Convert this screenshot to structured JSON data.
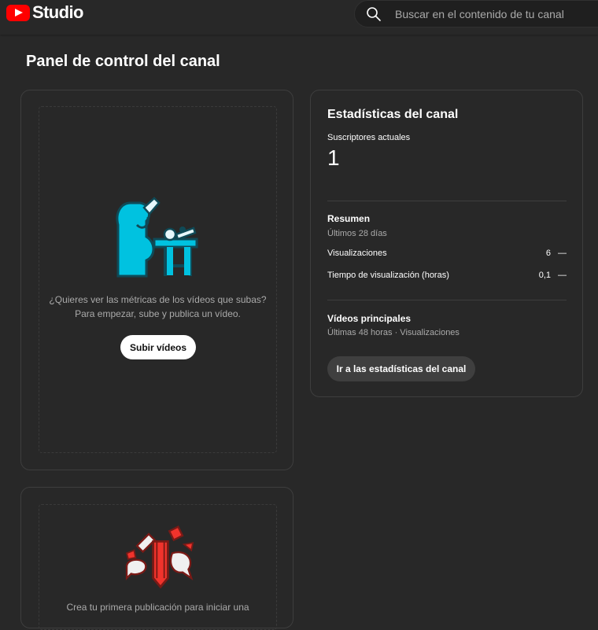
{
  "header": {
    "logo_text": "Studio",
    "search_placeholder": "Buscar en el contenido de tu canal"
  },
  "page": {
    "title": "Panel de control del canal"
  },
  "upload_card": {
    "message_line1": "¿Quieres ver las métricas de los vídeos que subas?",
    "message_line2": "Para empezar, sube y publica un vídeo.",
    "button_label": "Subir vídeos"
  },
  "stats_card": {
    "title": "Estadísticas del canal",
    "subscribers_label": "Suscriptores actuales",
    "subscribers_value": "1",
    "summary_title": "Resumen",
    "summary_period": "Últimos 28 días",
    "metrics": [
      {
        "label": "Visualizaciones",
        "value": "6",
        "trend": "—"
      },
      {
        "label": "Tiempo de visualización (horas)",
        "value": "0,1",
        "trend": "—"
      }
    ],
    "top_videos_title": "Vídeos principales",
    "top_videos_period": "Últimas 48 horas · Visualizaciones",
    "button_label": "Ir a las estadísticas del canal"
  },
  "post_card": {
    "message_line1": "Crea tu primera publicación para iniciar una"
  },
  "colors": {
    "brand_red": "#ff0000",
    "illustration_cyan": "#00c2e0",
    "illustration_red": "#f0332c",
    "background": "#282828"
  }
}
